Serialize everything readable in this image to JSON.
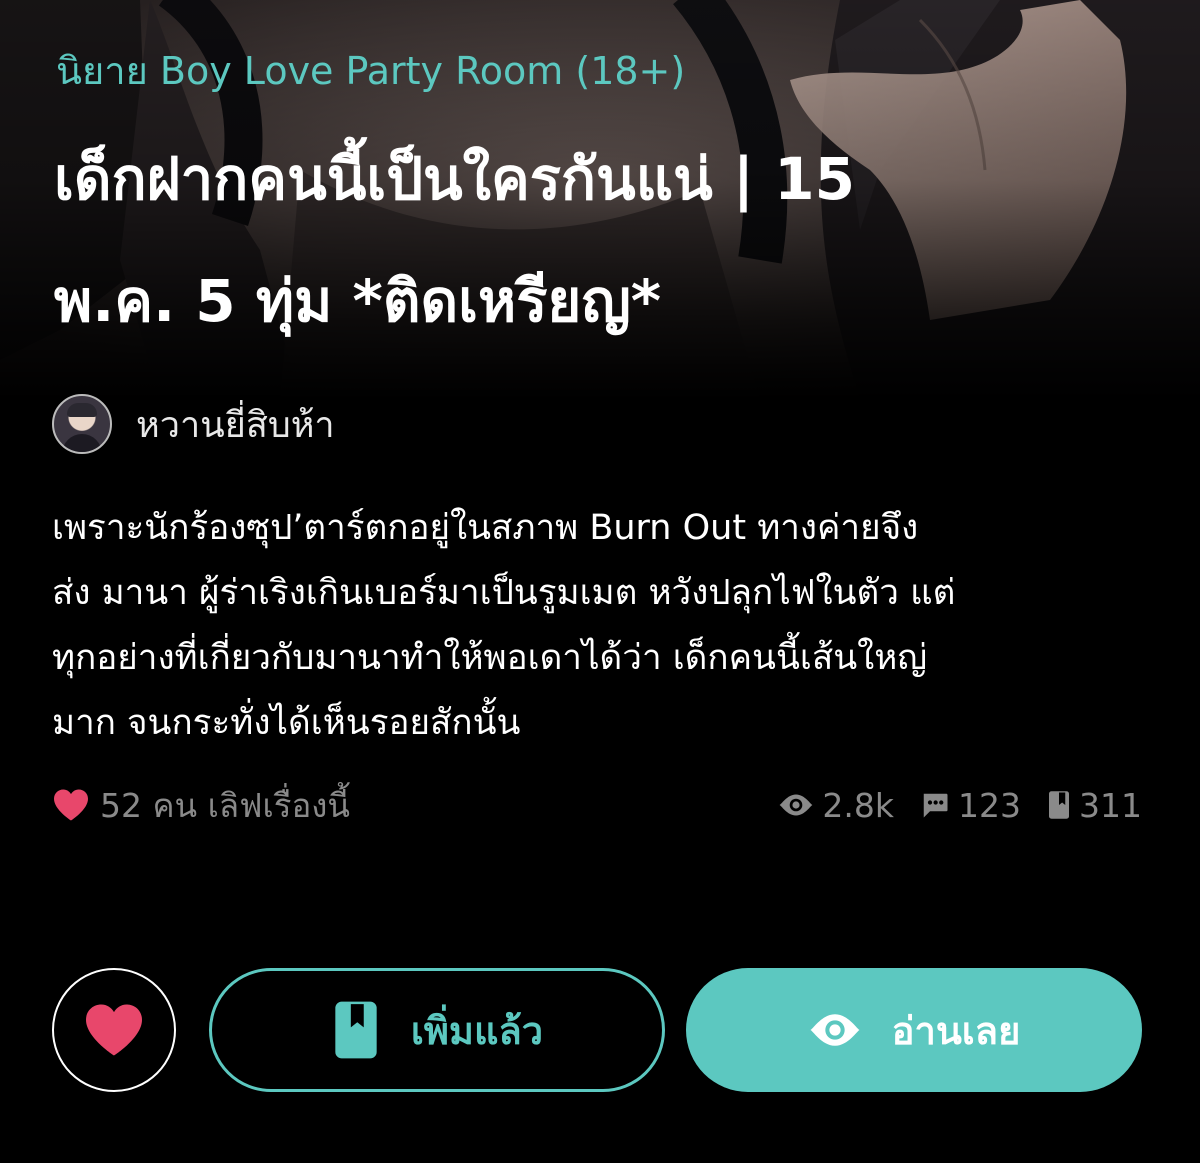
{
  "novel": {
    "category": "นิยาย Boy Love Party Room (18+)",
    "title_lines": [
      "เด็กฝากคนนี้เป็นใครกันแน่ | 15",
      "พ.ค. 5 ทุ่ม *ติดเหรียญ*"
    ],
    "author": "หวานยี่สิบห้า",
    "synopsis_lines": [
      "เพราะนักร้องซุป’ตาร์ตกอยู่ในสภาพ Burn Out ทางค่ายจึง",
      "ส่ง มานา ผู้ร่าเริงเกินเบอร์มาเป็นรูมเมต หวังปลุกไฟในตัว แต่",
      "ทุกอย่างที่เกี่ยวกับมานาทำให้พอเดาได้ว่า เด็กคนนี้เส้นใหญ่",
      "มาก จนกระทั่งได้เห็นรอยสักนั้น"
    ]
  },
  "stats": {
    "likes_text": "52 คน เลิฟเรื่องนี้",
    "views": "2.8k",
    "comments": "123",
    "bookmarks": "311"
  },
  "actions": {
    "library_label": "เพิ่มแล้ว",
    "read_label": "อ่านเลย"
  },
  "icons": {
    "heart": "heart-icon",
    "eye": "eye-icon",
    "comment": "comment-icon",
    "bookmark": "bookmark-icon"
  },
  "colors": {
    "accent": "#5cc8c0",
    "heart": "#e8476b",
    "muted": "#8a8a8a",
    "background": "#000000"
  }
}
